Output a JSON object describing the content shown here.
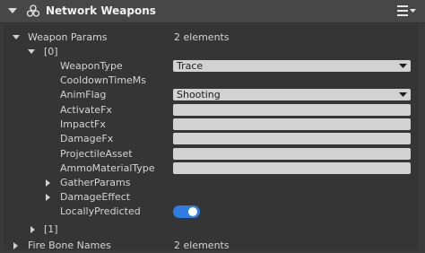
{
  "header": {
    "title": "Network Weapons",
    "icon": "network-icon",
    "menu_icon": "hamburger-menu-icon"
  },
  "properties": {
    "weapon_params": {
      "label": "Weapon Params",
      "value": "2 elements",
      "element0": {
        "label": "[0]",
        "weapon_type": {
          "label": "WeaponType",
          "value": "Trace"
        },
        "cooldown": {
          "label": "CooldownTimeMs"
        },
        "anim_flag": {
          "label": "AnimFlag",
          "value": "Shooting"
        },
        "activate_fx": {
          "label": "ActivateFx",
          "value": ""
        },
        "impact_fx": {
          "label": "ImpactFx",
          "value": ""
        },
        "damage_fx": {
          "label": "DamageFx",
          "value": ""
        },
        "projectile_asset": {
          "label": "ProjectileAsset",
          "value": ""
        },
        "ammo_material_type": {
          "label": "AmmoMaterialType",
          "value": ""
        },
        "gather_params": {
          "label": "GatherParams"
        },
        "damage_effect": {
          "label": "DamageEffect"
        },
        "locally_predicted": {
          "label": "LocallyPredicted",
          "value": true
        }
      },
      "element1": {
        "label": "[1]"
      }
    },
    "next_cut": {
      "label": "Fire Bone Names",
      "value": "2 elements"
    }
  },
  "colors": {
    "toggle_on": "#2f7de1",
    "field_bg": "#d2d2d2",
    "panel_bg": "#353535"
  }
}
